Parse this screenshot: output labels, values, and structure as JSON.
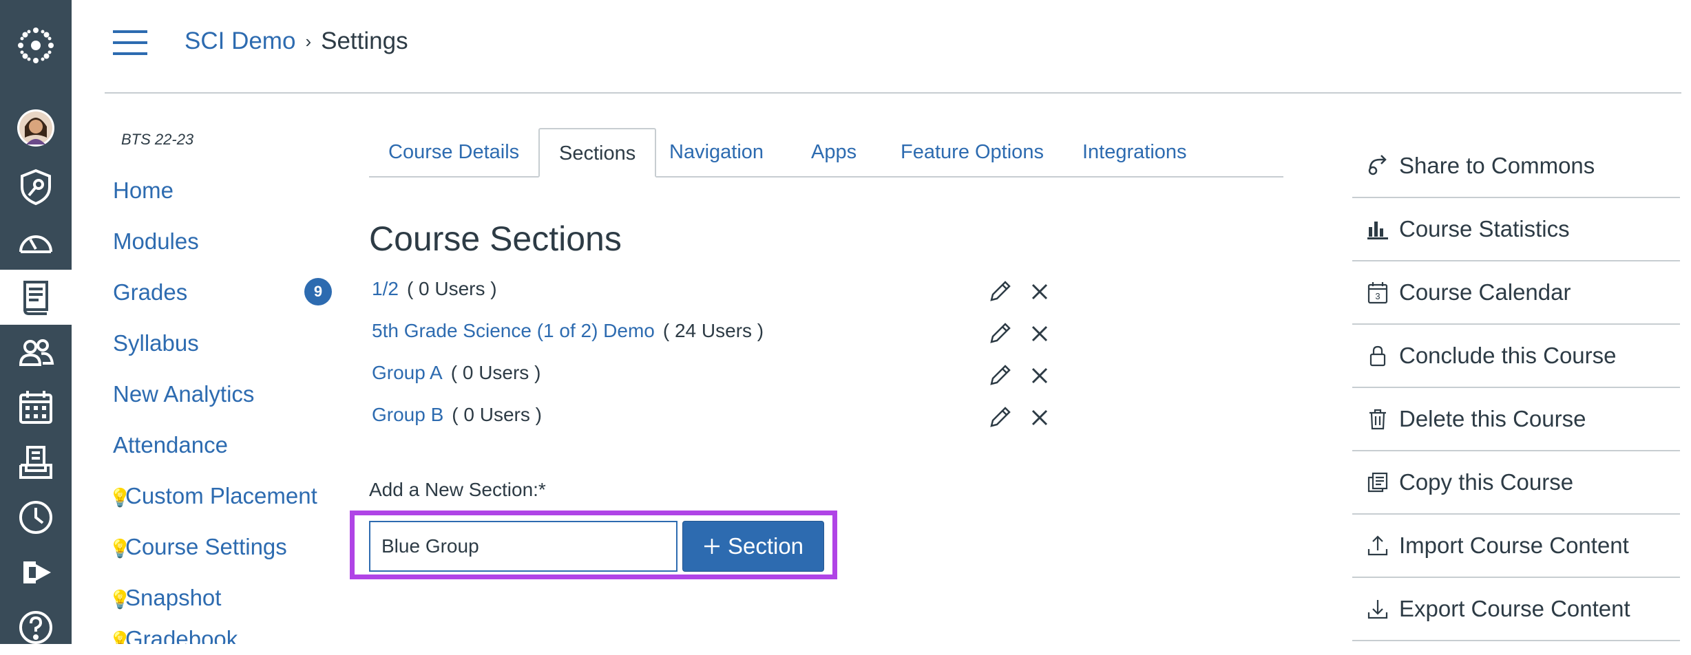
{
  "header": {
    "breadcrumb_course": "SCI Demo",
    "breadcrumb_sep": "›",
    "breadcrumb_current": "Settings"
  },
  "rail": {
    "items": [
      "logo-icon",
      "account-icon",
      "admin-icon",
      "dashboard-icon",
      "courses-icon",
      "groups-icon",
      "calendar-icon",
      "inbox-icon",
      "history-icon",
      "commons-icon",
      "help-icon"
    ],
    "active": "courses-icon"
  },
  "course_nav": {
    "term": "BTS 22-23",
    "items": [
      {
        "label": "Home",
        "bulb": false
      },
      {
        "label": "Modules",
        "bulb": false
      },
      {
        "label": "Grades",
        "bulb": false,
        "badge": "9"
      },
      {
        "label": "Syllabus",
        "bulb": false
      },
      {
        "label": "New Analytics",
        "bulb": false
      },
      {
        "label": "Attendance",
        "bulb": false
      },
      {
        "label": "Custom Placement",
        "bulb": true
      },
      {
        "label": "Course Settings",
        "bulb": true
      },
      {
        "label": "Snapshot",
        "bulb": true
      },
      {
        "label": "Gradebook",
        "bulb": true
      }
    ]
  },
  "tabs": [
    {
      "label": "Course Details",
      "active": false
    },
    {
      "label": "Sections",
      "active": true
    },
    {
      "label": "Navigation",
      "active": false
    },
    {
      "label": "Apps",
      "active": false
    },
    {
      "label": "Feature Options",
      "active": false
    },
    {
      "label": "Integrations",
      "active": false
    }
  ],
  "main": {
    "title": "Course Sections",
    "sections": [
      {
        "name": "1/2",
        "users": "( 0 Users )"
      },
      {
        "name": "5th Grade Science (1 of 2) Demo",
        "users": "( 24 Users )"
      },
      {
        "name": "Group A",
        "users": "( 0 Users )"
      },
      {
        "name": "Group B",
        "users": "( 0 Users )"
      }
    ],
    "add_label": "Add a New Section:*",
    "add_input_value": "Blue Group",
    "add_button_label": "Section",
    "highlight_color": "#b044e6"
  },
  "sidebar": {
    "items": [
      {
        "label": "Share to Commons",
        "icon": "share-icon"
      },
      {
        "label": "Course Statistics",
        "icon": "bar-chart-icon"
      },
      {
        "label": "Course Calendar",
        "icon": "calendar-icon"
      },
      {
        "label": "Conclude this Course",
        "icon": "lock-icon"
      },
      {
        "label": "Delete this Course",
        "icon": "trash-icon"
      },
      {
        "label": "Copy this Course",
        "icon": "copy-icon"
      },
      {
        "label": "Import Course Content",
        "icon": "upload-icon"
      },
      {
        "label": "Export Course Content",
        "icon": "download-icon"
      }
    ]
  },
  "colors": {
    "link": "#2d6bb0",
    "rail": "#394b58",
    "text": "#2d3b45"
  }
}
